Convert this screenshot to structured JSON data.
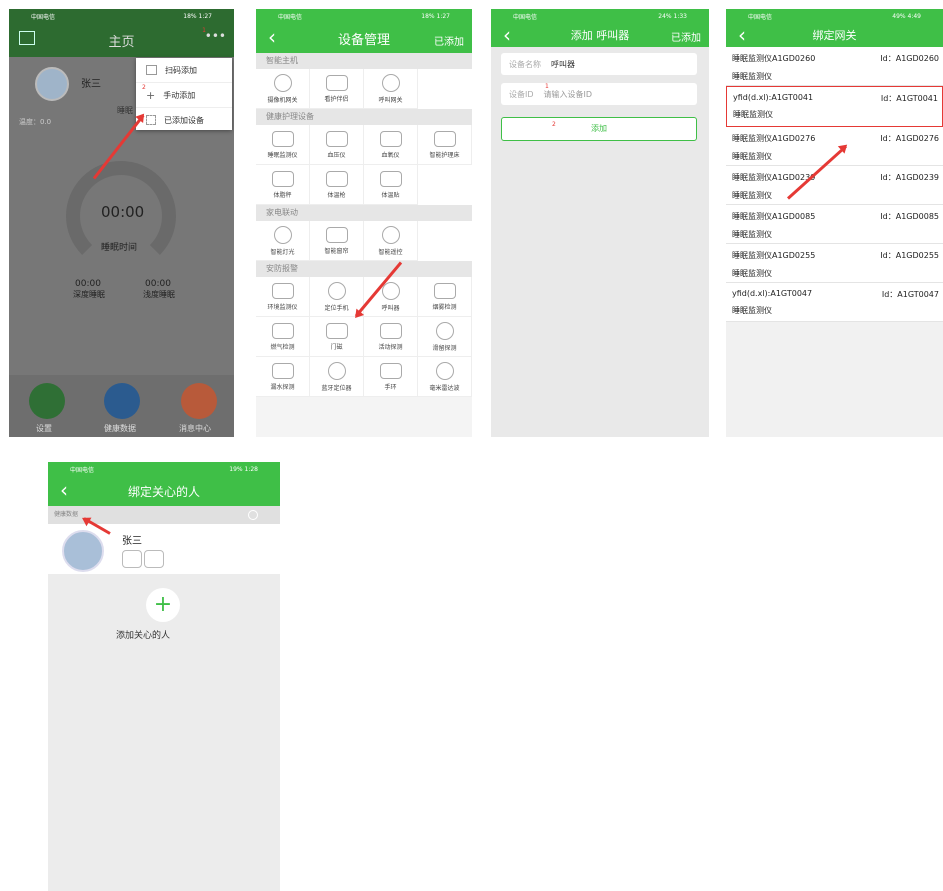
{
  "status": {
    "p1_left": "中国电信",
    "p1_right": "18% 1:27",
    "p2_left": "中国电信",
    "p2_right": "18% 1:27",
    "p3_left": "中国电信",
    "p3_right": "24% 1:33",
    "p4_left": "中国电信",
    "p4_right": "49% 4:49",
    "p5_left": "中国电信",
    "p5_right": "19% 1:28"
  },
  "screen1": {
    "title": "主页",
    "user": "张三",
    "temp": "温度：0.0",
    "sleep_label": "睡眠",
    "time": "00:00",
    "time_label": "睡眠时间",
    "deep_value": "00:00",
    "deep_label": "深度睡眠",
    "light_value": "00:00",
    "light_label": "浅度睡眠",
    "menu": [
      {
        "label": "扫码添加",
        "num": ""
      },
      {
        "label": "手动添加",
        "num": "2"
      },
      {
        "label": "已添加设备",
        "num": ""
      }
    ],
    "menu_num_top": "1",
    "bottom": [
      "设置",
      "健康数据",
      "消息中心"
    ]
  },
  "screen2": {
    "title": "设备管理",
    "right": "已添加",
    "sections": [
      {
        "title": "智能主机",
        "items": [
          "摄像机网关",
          "看护伴侣",
          "呼叫网关"
        ]
      },
      {
        "title": "健康护理设备",
        "items": [
          "睡眠监测仪",
          "血压仪",
          "血氧仪",
          "智能护理床",
          "体脂秤",
          "体温枪",
          "体温贴"
        ]
      },
      {
        "title": "家电联动",
        "items": [
          "智能灯光",
          "智能窗帘",
          "智能遥控"
        ]
      },
      {
        "title": "安防报警",
        "items": [
          "环境监测仪",
          "定位手机",
          "呼叫器",
          "烟雾检测",
          "燃气检测",
          "门磁",
          "活动探测",
          "滑留探测",
          "漏水探测",
          "蓝牙定位器",
          "手环",
          "毫米雷达波"
        ]
      }
    ]
  },
  "screen3": {
    "title": "添加 呼叫器",
    "right": "已添加",
    "name_label": "设备名称",
    "name_value": "呼叫器",
    "id_label": "设备ID",
    "id_placeholder": "请输入设备ID",
    "id_num": "1",
    "add_num": "2",
    "add_label": "添加"
  },
  "screen4": {
    "title": "绑定网关",
    "rows": [
      {
        "name": "睡眠监测仪A1GD0260",
        "type": "睡眠监测仪",
        "id": "Id：A1GD0260"
      },
      {
        "name": "yfid(d.xl):A1GT0041",
        "type": "睡眠监测仪",
        "id": "Id：A1GT0041"
      },
      {
        "name": "睡眠监测仪A1GD0276",
        "type": "睡眠监测仪",
        "id": "Id：A1GD0276"
      },
      {
        "name": "睡眠监测仪A1GD0239",
        "type": "睡眠监测仪",
        "id": "Id：A1GD0239"
      },
      {
        "name": "睡眠监测仪A1GD0085",
        "type": "睡眠监测仪",
        "id": "Id：A1GD0085"
      },
      {
        "name": "睡眠监测仪A1GD0255",
        "type": "睡眠监测仪",
        "id": "Id：A1GD0255"
      },
      {
        "name": "yfid(d.xl):A1GT0047",
        "type": "睡眠监测仪",
        "id": "Id：A1GT0047"
      }
    ]
  },
  "screen5": {
    "title": "绑定关心的人",
    "search_placeholder": "健康数据",
    "user": "张三",
    "add_label": "添加关心的人"
  },
  "colors": {
    "green": "#3fbf47",
    "red": "#e53935"
  },
  "icons": [
    "back-icon",
    "more-icon",
    "scan-icon",
    "plus-icon",
    "grid-icon",
    "search-icon",
    "settings-icon",
    "health-icon",
    "message-icon",
    "avatar"
  ]
}
